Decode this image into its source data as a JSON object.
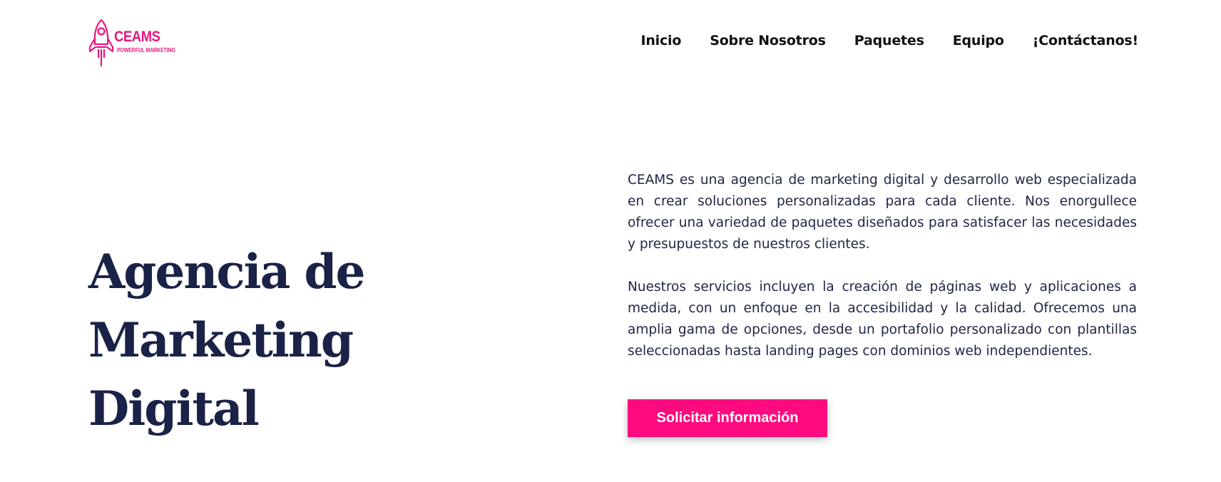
{
  "brand": {
    "name": "CEAMS",
    "tagline": "POWERFUL MARKETING",
    "color": "#e8157e",
    "icon": "rocket-icon"
  },
  "nav": {
    "items": [
      {
        "label": "Inicio"
      },
      {
        "label": "Sobre Nosotros"
      },
      {
        "label": "Paquetes"
      },
      {
        "label": "Equipo"
      },
      {
        "label": "¡Contáctanos!"
      }
    ]
  },
  "hero": {
    "title_line1": "Agencia de Marketing",
    "title_line2": "Digital",
    "paragraph1": "CEAMS es una agencia de marketing digital y desarrollo web especializada en crear soluciones personalizadas para cada cliente. Nos enorgullece ofrecer una variedad de paquetes diseñados para satisfacer las necesidades y presupuestos de nuestros clientes.",
    "paragraph2": "Nuestros servicios incluyen la creación de páginas web y aplicaciones a medida, con un enfoque en la accesibilidad y la calidad. Ofrecemos una amplia gama de opciones, desde un portafolio personalizado con plantillas seleccionadas hasta landing pages con dominios web independientes.",
    "cta_label": "Solicitar información",
    "cta_color": "#ff0a7f",
    "title_color": "#1b2247"
  }
}
